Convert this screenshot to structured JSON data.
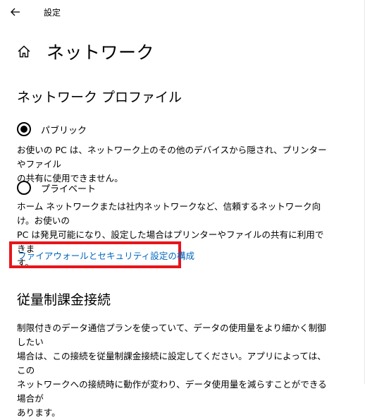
{
  "window": {
    "app_title": "設定",
    "back_icon": "back-arrow-icon"
  },
  "page": {
    "title": "ネットワーク",
    "home_icon": "home-icon"
  },
  "profile_section": {
    "title": "ネットワーク プロファイル",
    "options": [
      {
        "label": "パブリック",
        "selected": true,
        "description_lines": [
          "お使いの PC は、ネットワーク上のその他のデバイスから隠され、プリンターやファイル",
          "の共有に使用できません。"
        ]
      },
      {
        "label": "プライベート",
        "selected": false,
        "description_lines": [
          "ホーム ネットワークまたは社内ネットワークなど、信頼するネットワーク向け。お使いの",
          "PC は発見可能になり、設定した場合はプリンターやファイルの共有に利用できま",
          "す。"
        ]
      }
    ],
    "firewall_link": "ファイアウォールとセキュリティ設定の構成"
  },
  "metered_section": {
    "title": "従量制課金接続",
    "description_lines": [
      "制限付きのデータ通信プランを使っていて、データの使用量をより細かく制御したい",
      "場合は、この接続を従量制課金接続に設定してください。アプリによっては、この",
      "ネットワークへの接続時に動作が変わり、データ使用量を減らすことができる場合が",
      "あります。"
    ]
  },
  "colors": {
    "link": "#0067c0",
    "highlight_border": "#e8141b"
  }
}
